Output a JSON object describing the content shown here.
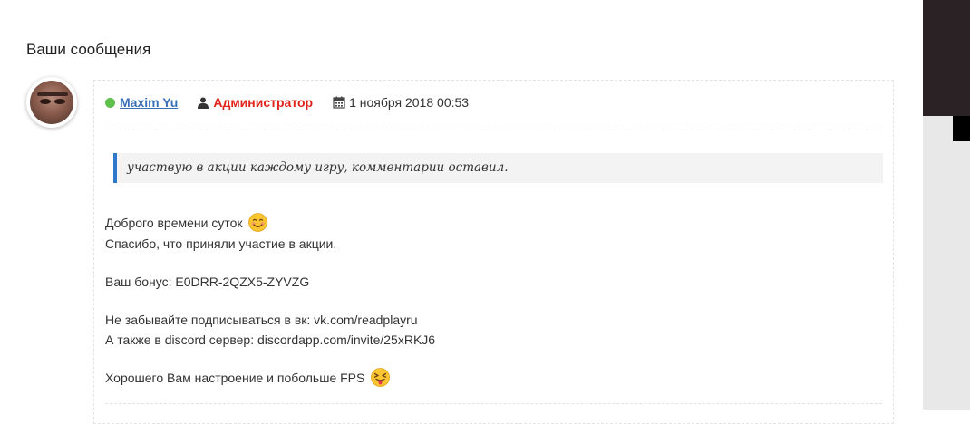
{
  "section": {
    "title": "Ваши сообщения"
  },
  "comment": {
    "author": "Maxim Yu",
    "role": "Администратор",
    "date": "1 ноября 2018 00:53",
    "quote": "участвую в акции каждому игру, комментарии оставил.",
    "reply": {
      "line1": "Доброго времени суток",
      "line2": "Спасибо, что приняли участие в акции.",
      "line3": "Ваш бонус: E0DRR-2QZX5-ZYVZG",
      "line4": "Не забывайте подписываться в вк: vk.com/readplayru",
      "line5": "А также в discord сервер: discordapp.com/invite/25xRKJ6",
      "line6": "Хорошего Вам настроение и побольше FPS"
    },
    "icons": {
      "online": "online-dot",
      "role": "user-icon",
      "date": "calendar-icon",
      "emoji1": "smile-emoji",
      "emoji2": "tongue-emoji"
    },
    "colors": {
      "online": "#5cc04a",
      "author_link": "#3a6fb5",
      "role": "#e0231a",
      "quote_border": "#2d78c8"
    }
  }
}
